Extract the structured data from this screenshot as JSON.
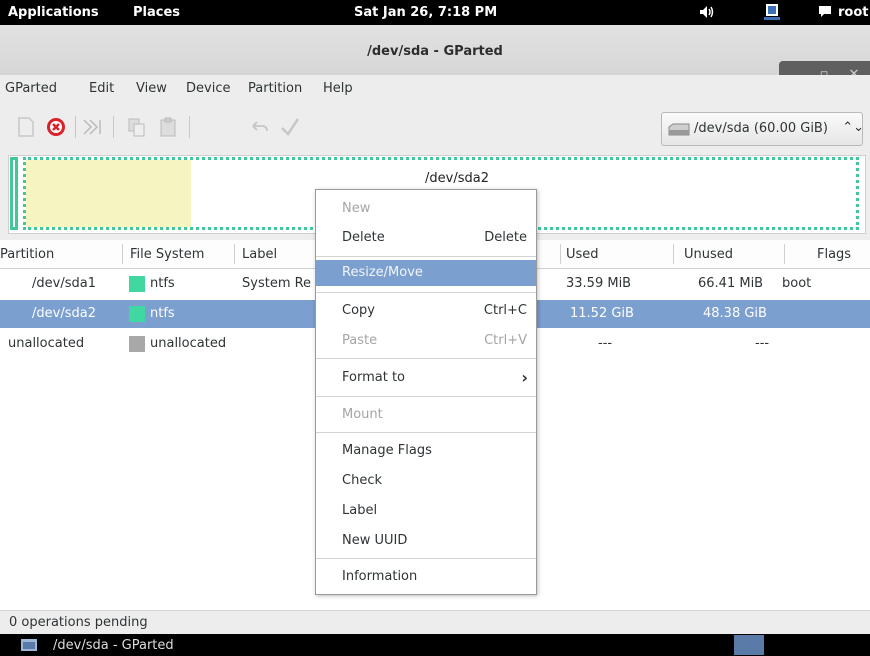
{
  "topbar": {
    "applications": "Applications",
    "places": "Places",
    "clock": "Sat Jan 26,  7:18 PM",
    "user": "root"
  },
  "window": {
    "title": "/dev/sda - GParted",
    "min": "_",
    "max": "▫",
    "close": "✕"
  },
  "menubar": [
    "GParted",
    "Edit",
    "View",
    "Device",
    "Partition",
    "Help"
  ],
  "device_selector": {
    "label": "/dev/sda  (60.00 GiB)",
    "arrows": "⌃⌄"
  },
  "diskmap": {
    "selected_label": "/dev/sda2"
  },
  "columns": [
    "Partition",
    "File System",
    "Label",
    "Used",
    "Unused",
    "Flags"
  ],
  "rows": [
    {
      "partition": "/dev/sda1",
      "fs": "ntfs",
      "label": "System Re",
      "used": "33.59 MiB",
      "unused": "66.41 MiB",
      "flags": "boot",
      "fs_color": "#40d8a0"
    },
    {
      "partition": "/dev/sda2",
      "fs": "ntfs",
      "label": "",
      "used": "11.52 GiB",
      "unused": "48.38 GiB",
      "flags": "",
      "fs_color": "#40d8a0"
    },
    {
      "partition": "unallocated",
      "fs": "unallocated",
      "label": "",
      "used": "---",
      "unused": "---",
      "flags": "",
      "fs_color": "#a8a8a8"
    }
  ],
  "context_menu": {
    "new": "New",
    "delete": "Delete",
    "delete_acc": "Delete",
    "resize": "Resize/Move",
    "copy": "Copy",
    "copy_acc": "Ctrl+C",
    "paste": "Paste",
    "paste_acc": "Ctrl+V",
    "format": "Format to",
    "mount": "Mount",
    "flags": "Manage Flags",
    "check": "Check",
    "label": "Label",
    "uuid": "New UUID",
    "info": "Information"
  },
  "status": "0 operations pending",
  "taskbar": {
    "task": "/dev/sda - GParted"
  },
  "colors": {
    "selection": "#7b9fcf",
    "ntfs": "#40d8a0",
    "unallocated": "#a8a8a8"
  }
}
